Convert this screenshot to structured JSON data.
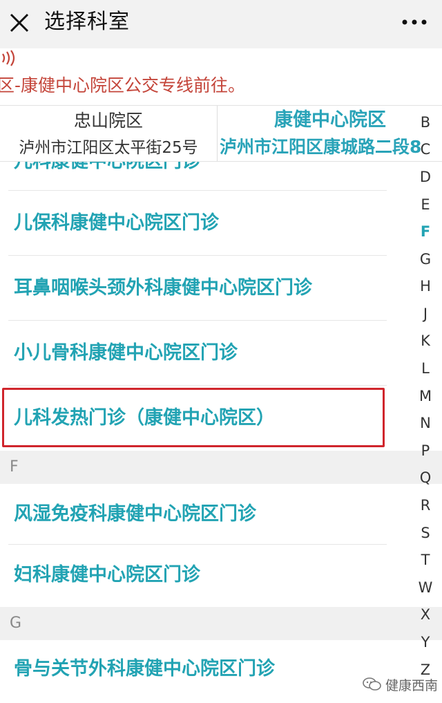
{
  "header": {
    "title": "选择科室",
    "close_icon": "close-icon",
    "more_icon": "more-icon"
  },
  "notice": {
    "icon": "speaker-icon",
    "text": "区-康健中心院区公交专线前往。",
    "color": "#c4453a"
  },
  "campus_tabs": [
    {
      "name": "忠山院区",
      "address": "泸州市江阳区太平街25号",
      "selected": false
    },
    {
      "name": "康健中心院区",
      "address": "泸州市江阳区康城路二段8",
      "selected": true
    }
  ],
  "departments": {
    "partial_top": "儿科康健中心院区门诊",
    "items_before_f": [
      "儿保科康健中心院区门诊",
      "耳鼻咽喉头颈外科康健中心院区门诊",
      "小儿骨科康健中心院区门诊",
      "儿科发热门诊（康健中心院区）"
    ],
    "section_f": {
      "letter": "F",
      "items": [
        "风湿免疫科康健中心院区门诊",
        "妇科康健中心院区门诊"
      ]
    },
    "section_g": {
      "letter": "G",
      "items": [
        "骨与关节外科康健中心院区门诊"
      ]
    }
  },
  "alpha_index": {
    "letters": [
      "B",
      "C",
      "D",
      "E",
      "F",
      "G",
      "H",
      "J",
      "K",
      "L",
      "M",
      "N",
      "P",
      "Q",
      "R",
      "S",
      "T",
      "W",
      "X",
      "Y",
      "Z"
    ],
    "active": "F"
  },
  "watermark": {
    "icon": "wechat-icon",
    "text": "健康西南"
  },
  "colors": {
    "accent": "#22a3b3",
    "highlight": "#d0252c"
  }
}
